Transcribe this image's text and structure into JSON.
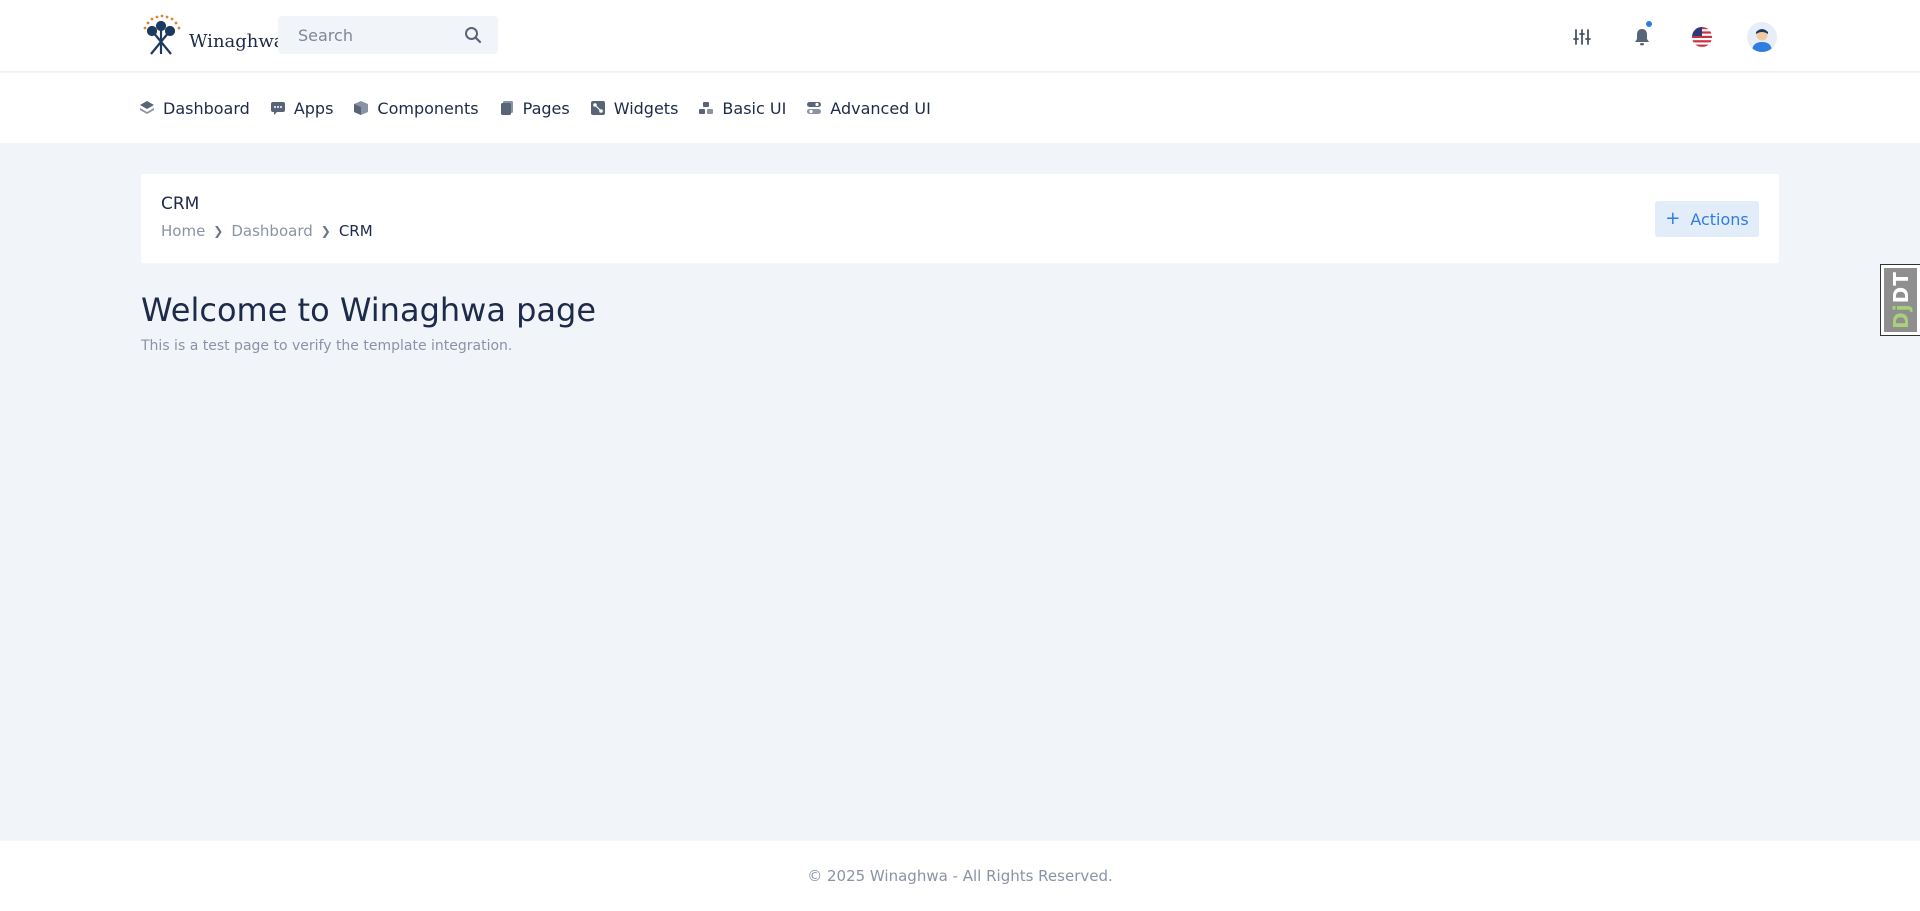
{
  "brand": {
    "name": "Winaghwa"
  },
  "search": {
    "placeholder": "Search"
  },
  "header": {
    "icons": [
      "settings-sliders-icon",
      "bell-icon",
      "us-flag-icon",
      "user-avatar"
    ],
    "notification_dot_color": "#2f7de1"
  },
  "nav": {
    "items": [
      {
        "label": "Dashboard",
        "icon": "layers-icon"
      },
      {
        "label": "Apps",
        "icon": "chat-icon"
      },
      {
        "label": "Components",
        "icon": "box-icon"
      },
      {
        "label": "Pages",
        "icon": "file-icon"
      },
      {
        "label": "Widgets",
        "icon": "widgets-icon"
      },
      {
        "label": "Basic UI",
        "icon": "blocks-icon"
      },
      {
        "label": "Advanced UI",
        "icon": "toggle-icon"
      }
    ]
  },
  "page_header": {
    "title": "CRM",
    "breadcrumb": [
      "Home",
      "Dashboard",
      "CRM"
    ],
    "actions_label": "Actions"
  },
  "main": {
    "heading": "Welcome to Winaghwa page",
    "subtext": "This is a test page to verify the template integration."
  },
  "debug_toolbar": {
    "label_dj": "Dj",
    "label_dt": "DT"
  },
  "footer": {
    "text": "© 2025 Winaghwa - All Rights Reserved."
  },
  "colors": {
    "accent": "#2f7de1",
    "text": "#1e2a4a",
    "muted": "#8a93a6",
    "background": "#f1f4f9"
  }
}
